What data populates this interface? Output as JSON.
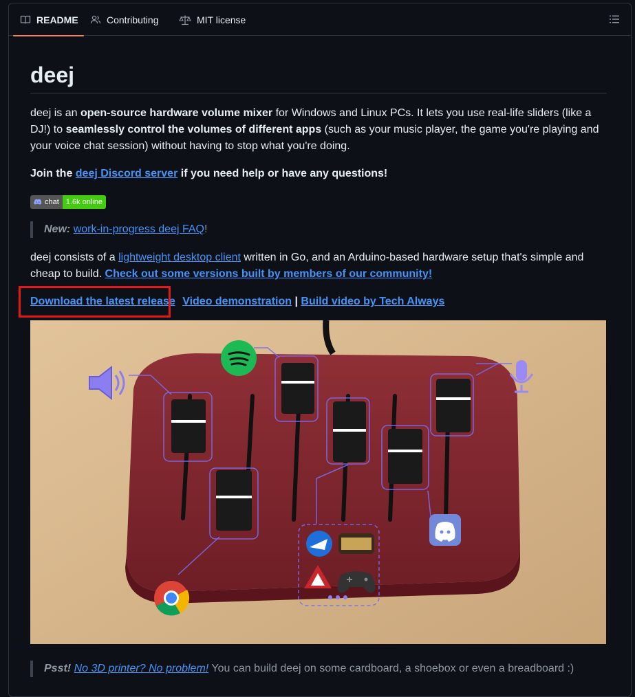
{
  "tabs": [
    {
      "label": "README",
      "icon": "book-icon"
    },
    {
      "label": "Contributing",
      "icon": "people-icon"
    },
    {
      "label": "MIT license",
      "icon": "scale-icon"
    }
  ],
  "title": "deej",
  "intro": {
    "t1": "deej is an ",
    "b1": "open-source hardware volume mixer",
    "t2": " for Windows and Linux PCs. It lets you use real-life sliders (like a DJ!) to ",
    "b2": "seamlessly control the volumes of different apps",
    "t3": " (such as your music player, the game you're playing and your voice chat session) without having to stop what you're doing."
  },
  "join": {
    "pre": "Join the ",
    "link": "deej Discord server",
    "post": " if you need help or have any questions!"
  },
  "badge": {
    "left": "chat",
    "right": "1.6k online"
  },
  "faq": {
    "label": "New:",
    "link": "work-in-progress deej FAQ",
    "end": "!"
  },
  "consists": {
    "t1": "deej consists of a ",
    "link1": "lightweight desktop client",
    "t2": " written in Go, and an Arduino-based hardware setup that's simple and cheap to build. ",
    "link2": "Check out some versions built by members of our community!"
  },
  "links": {
    "download": "Download the latest release",
    "video": "Video demonstration",
    "sep": "|",
    "build": "Build video by Tech Always"
  },
  "psst": {
    "label": "Psst!",
    "link": "No 3D printer? No problem!",
    "text": " You can build deej on some cardboard, a shoebox or even a breadboard :)"
  },
  "colors": {
    "accent": "#f78166",
    "link": "#4493f8",
    "highlight": "#e0191b"
  }
}
